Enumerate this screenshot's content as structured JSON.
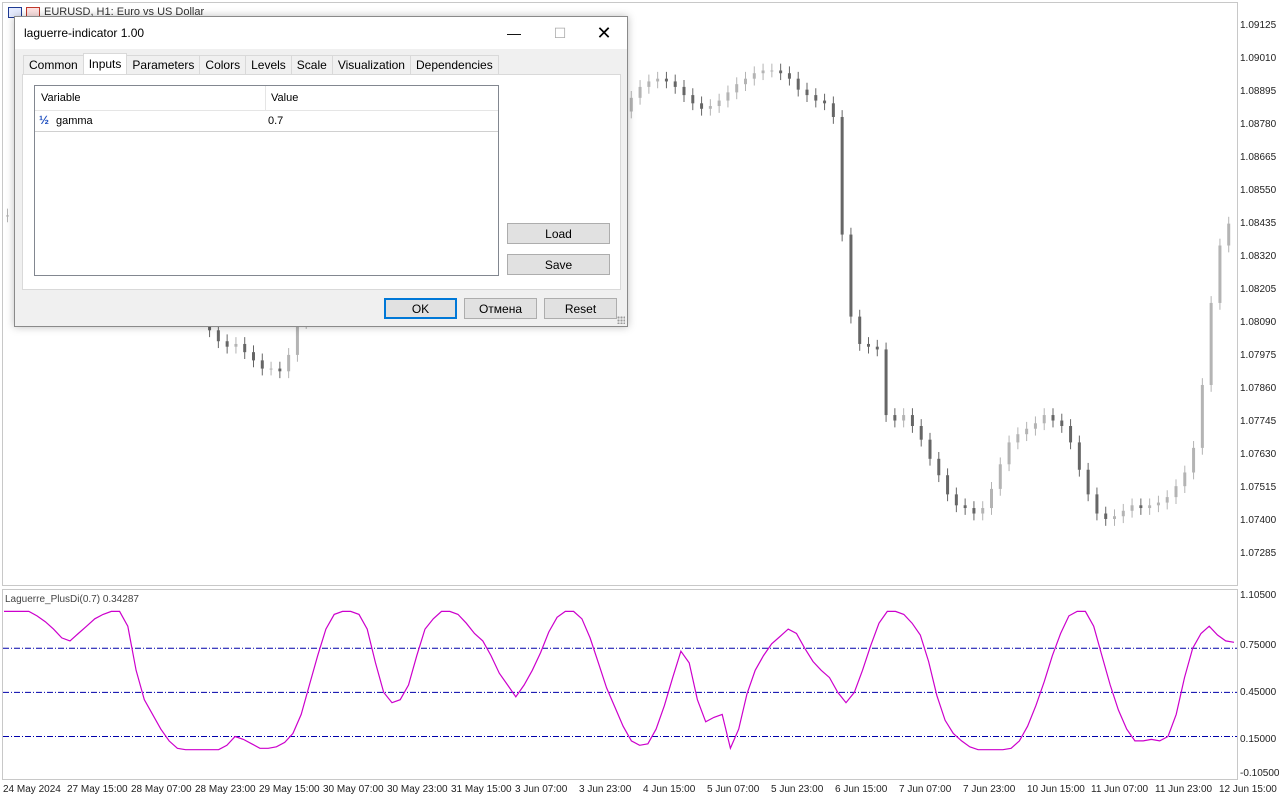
{
  "window": {
    "chart_title": "EURUSD, H1:  Euro vs US Dollar"
  },
  "price_axis": [
    "1.09125",
    "1.09010",
    "1.08895",
    "1.08780",
    "1.08665",
    "1.08550",
    "1.08435",
    "1.08320",
    "1.08205",
    "1.08090",
    "1.07975",
    "1.07860",
    "1.07745",
    "1.07630",
    "1.07515",
    "1.07400",
    "1.07285"
  ],
  "indicator": {
    "title": "Laguerre_PlusDi(0.7) 0.34287",
    "levels": [
      "1.10500",
      "0.75000",
      "0.45000",
      "0.15000",
      "-0.10500"
    ]
  },
  "time_axis": [
    "24 May 2024",
    "27 May 15:00",
    "28 May 07:00",
    "28 May 23:00",
    "29 May 15:00",
    "30 May 07:00",
    "30 May 23:00",
    "31 May 15:00",
    "3 Jun 07:00",
    "3 Jun 23:00",
    "4 Jun 15:00",
    "5 Jun 07:00",
    "5 Jun 23:00",
    "6 Jun 15:00",
    "7 Jun 07:00",
    "7 Jun 23:00",
    "10 Jun 15:00",
    "11 Jun 07:00",
    "11 Jun 23:00",
    "12 Jun 15:00"
  ],
  "dialog": {
    "title": "laguerre-indicator 1.00",
    "minimize": "—",
    "maximize": "☐",
    "close": "✕",
    "tabs": [
      "Common",
      "Inputs",
      "Parameters",
      "Colors",
      "Levels",
      "Scale",
      "Visualization",
      "Dependencies"
    ],
    "active_tab": "Inputs",
    "grid": {
      "col_variable": "Variable",
      "col_value": "Value",
      "rows": [
        {
          "icon": "½",
          "variable": "gamma",
          "value": "0.7"
        }
      ]
    },
    "load_label": "Load",
    "save_label": "Save",
    "ok_label": "OK",
    "cancel_label": "Отмена",
    "reset_label": "Reset"
  },
  "colors": {
    "indicator_line": "#cc00cc",
    "level_line": "#0000aa",
    "candle_dark": "#666666",
    "candle_light": "#b4b4b4",
    "ok_border": "#0078d7"
  },
  "icons": {
    "window_icons": [
      "chart-icon",
      "bars-icon"
    ],
    "variable_icon": "fraction-half-icon",
    "resize_grip": "resize-grip-icon"
  },
  "series": {
    "price_close": [
      1.0847,
      1.0851,
      1.0853,
      1.0855,
      1.0857,
      1.0859,
      1.0861,
      1.0864,
      1.0866,
      1.0868,
      1.0869,
      1.0867,
      1.0864,
      1.0862,
      1.0861,
      1.0858,
      1.0854,
      1.0849,
      1.0842,
      1.0834,
      1.0826,
      1.0818,
      1.0811,
      1.0805,
      1.0801,
      1.0799,
      1.08,
      1.0797,
      1.0794,
      1.0791,
      1.0791,
      1.079,
      1.0796,
      1.0808,
      1.0818,
      1.0827,
      1.0836,
      1.0843,
      1.0851,
      1.0858,
      1.0863,
      1.0867,
      1.087,
      1.087,
      1.0869,
      1.0866,
      1.0865,
      1.0867,
      1.0866,
      1.0864,
      1.0866,
      1.087,
      1.0876,
      1.0881,
      1.0884,
      1.0887,
      1.0886,
      1.0884,
      1.088,
      1.0879,
      1.0878,
      1.0876,
      1.0875,
      1.0874,
      1.0872,
      1.087,
      1.087,
      1.0873,
      1.0877,
      1.0881,
      1.0885,
      1.089,
      1.0894,
      1.0896,
      1.0897,
      1.0896,
      1.0894,
      1.0891,
      1.0888,
      1.0886,
      1.0887,
      1.0889,
      1.0892,
      1.0895,
      1.0897,
      1.0899,
      1.09,
      1.09,
      1.0899,
      1.0897,
      1.0893,
      1.0891,
      1.0889,
      1.0888,
      1.0883,
      1.084,
      1.081,
      1.08,
      1.0799,
      1.0798,
      1.0774,
      1.0772,
      1.0774,
      1.077,
      1.0765,
      1.0758,
      1.0752,
      1.0745,
      1.0741,
      1.074,
      1.0738,
      1.074,
      1.0747,
      1.0756,
      1.0764,
      1.0767,
      1.0769,
      1.0771,
      1.0774,
      1.0772,
      1.077,
      1.0764,
      1.0754,
      1.0745,
      1.0738,
      1.0736,
      1.0737,
      1.0739,
      1.0741,
      1.074,
      1.0741,
      1.0742,
      1.0744,
      1.0748,
      1.0753,
      1.0762,
      1.0785,
      1.0815,
      1.0836,
      1.0844
    ],
    "laguerre": [
      1.0,
      1.0,
      1.0,
      1.0,
      0.97,
      0.93,
      0.88,
      0.82,
      0.8,
      0.85,
      0.9,
      0.95,
      0.98,
      1.0,
      1.0,
      0.9,
      0.6,
      0.4,
      0.3,
      0.2,
      0.12,
      0.07,
      0.06,
      0.06,
      0.06,
      0.06,
      0.06,
      0.09,
      0.15,
      0.13,
      0.1,
      0.07,
      0.07,
      0.08,
      0.11,
      0.17,
      0.3,
      0.5,
      0.7,
      0.88,
      0.98,
      1.0,
      1.0,
      0.98,
      0.88,
      0.65,
      0.45,
      0.38,
      0.4,
      0.5,
      0.7,
      0.88,
      0.95,
      1.0,
      1.0,
      0.98,
      0.92,
      0.85,
      0.8,
      0.7,
      0.58,
      0.5,
      0.42,
      0.5,
      0.6,
      0.72,
      0.86,
      0.96,
      1.0,
      1.0,
      0.95,
      0.82,
      0.65,
      0.48,
      0.35,
      0.22,
      0.12,
      0.09,
      0.1,
      0.2,
      0.36,
      0.55,
      0.73,
      0.65,
      0.4,
      0.25,
      0.28,
      0.3,
      0.07,
      0.2,
      0.44,
      0.6,
      0.7,
      0.78,
      0.83,
      0.88,
      0.85,
      0.75,
      0.66,
      0.6,
      0.55,
      0.45,
      0.38,
      0.45,
      0.6,
      0.77,
      0.92,
      1.0,
      1.0,
      0.98,
      0.92,
      0.84,
      0.66,
      0.43,
      0.26,
      0.17,
      0.12,
      0.08,
      0.06,
      0.06,
      0.06,
      0.06,
      0.07,
      0.12,
      0.22,
      0.36,
      0.52,
      0.7,
      0.85,
      0.97,
      1.0,
      1.0,
      0.9,
      0.7,
      0.5,
      0.33,
      0.2,
      0.12,
      0.12,
      0.13,
      0.12,
      0.15,
      0.3,
      0.55,
      0.75,
      0.85,
      0.9,
      0.84,
      0.8,
      0.79
    ]
  }
}
